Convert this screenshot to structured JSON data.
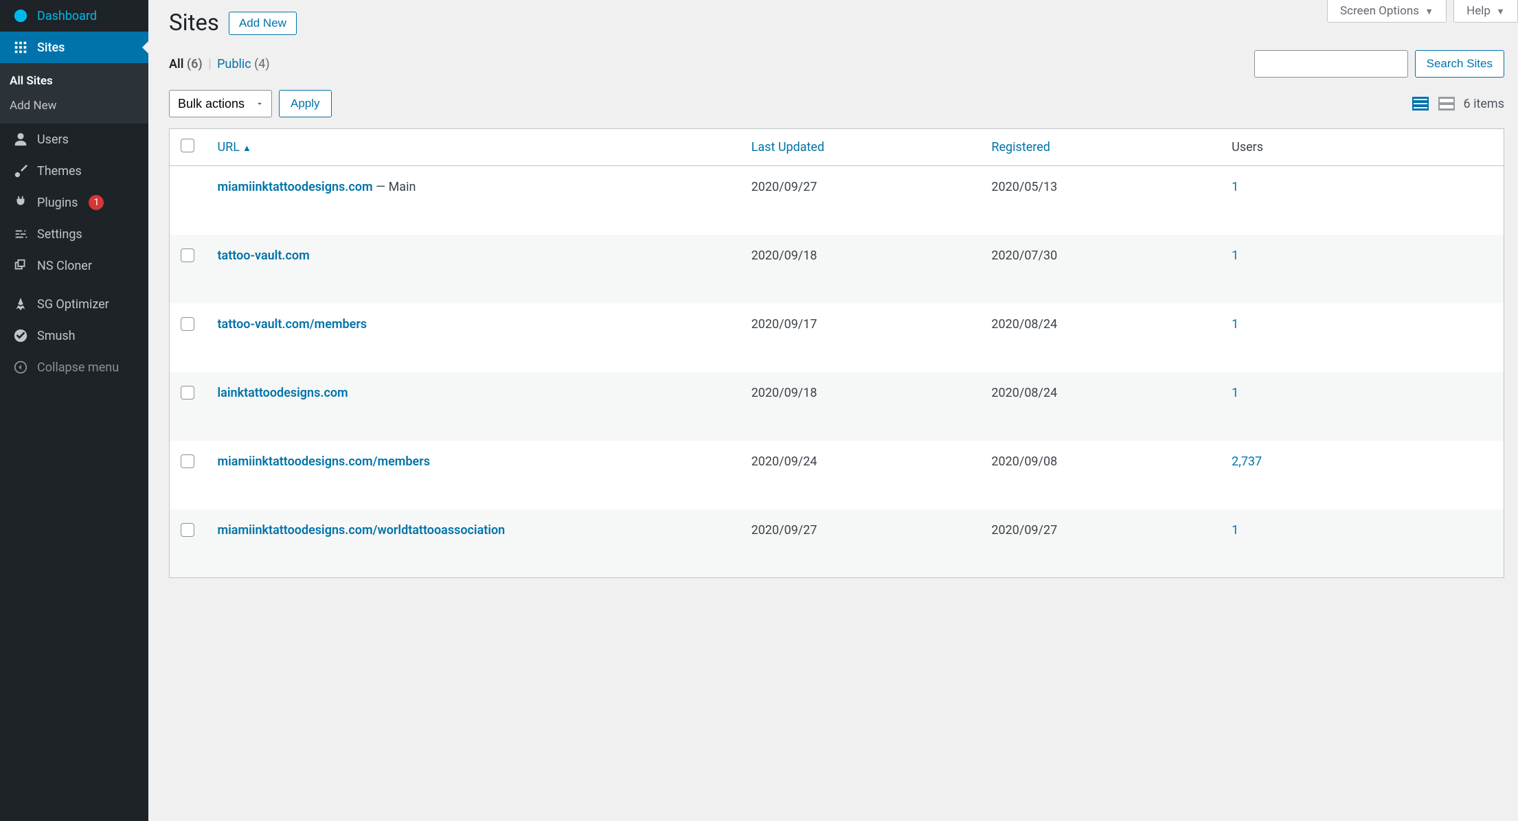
{
  "sidebar": {
    "dashboard": "Dashboard",
    "sites": "Sites",
    "all_sites": "All Sites",
    "add_new": "Add New",
    "users": "Users",
    "themes": "Themes",
    "plugins": "Plugins",
    "plugins_badge": "1",
    "settings": "Settings",
    "ns_cloner": "NS Cloner",
    "sg_optimizer": "SG Optimizer",
    "smush": "Smush",
    "collapse": "Collapse menu"
  },
  "top_tabs": {
    "screen_options": "Screen Options",
    "help": "Help"
  },
  "header": {
    "title": "Sites",
    "add_new": "Add New"
  },
  "filters": {
    "all_label": "All",
    "all_count": "(6)",
    "public_label": "Public",
    "public_count": "(4)"
  },
  "search": {
    "button": "Search Sites"
  },
  "bulk": {
    "select": "Bulk actions",
    "apply": "Apply"
  },
  "items_count": "6 items",
  "columns": {
    "url": "URL",
    "last_updated": "Last Updated",
    "registered": "Registered",
    "users": "Users"
  },
  "rows": [
    {
      "url": "miamiinktattoodesigns.com",
      "suffix": " — Main",
      "updated": "2020/09/27",
      "registered": "2020/05/13",
      "users": "1"
    },
    {
      "url": "tattoo-vault.com",
      "suffix": "",
      "updated": "2020/09/18",
      "registered": "2020/07/30",
      "users": "1"
    },
    {
      "url": "tattoo-vault.com/members",
      "suffix": "",
      "updated": "2020/09/17",
      "registered": "2020/08/24",
      "users": "1"
    },
    {
      "url": "lainktattoodesigns.com",
      "suffix": "",
      "updated": "2020/09/18",
      "registered": "2020/08/24",
      "users": "1"
    },
    {
      "url": "miamiinktattoodesigns.com/members",
      "suffix": "",
      "updated": "2020/09/24",
      "registered": "2020/09/08",
      "users": "2,737"
    },
    {
      "url": "miamiinktattoodesigns.com/worldtattooassociation",
      "suffix": "",
      "updated": "2020/09/27",
      "registered": "2020/09/27",
      "users": "1"
    }
  ]
}
